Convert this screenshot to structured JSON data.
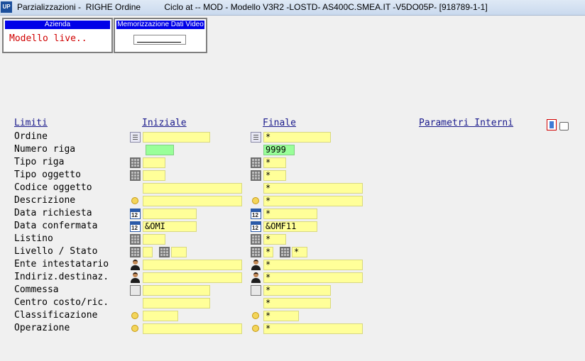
{
  "window": {
    "app_icon": "UP",
    "title": "Parzializzazioni -  RIGHE Ordine          Ciclo at -- MOD - Modello V3R2 -LOSTD- AS400C.SMEA.IT -V5DO05P- [918789-1-1]"
  },
  "azienda": {
    "header": "Azienda",
    "value": "Modello live.."
  },
  "memorizzazione": {
    "header": "Memorizzazione Dati Video",
    "value": ""
  },
  "columns": {
    "limiti": "Limiti",
    "iniziale": "Iniziale",
    "finale": "Finale",
    "parametri": "Parametri Interni"
  },
  "rows": [
    {
      "label": "Ordine",
      "icon": "document-list-icon",
      "ini": "",
      "fin": "*"
    },
    {
      "label": "Numero riga",
      "icon": "",
      "ini": "",
      "fin": "9999"
    },
    {
      "label": "Tipo riga",
      "icon": "table-grid-icon",
      "ini": "",
      "fin": "*"
    },
    {
      "label": "Tipo oggetto",
      "icon": "table-grid-icon",
      "ini": "",
      "fin": "*"
    },
    {
      "label": "Codice oggetto",
      "icon": "",
      "ini": "",
      "fin": "*"
    },
    {
      "label": "Descrizione",
      "icon": "circle-icon",
      "ini": "",
      "fin": "*"
    },
    {
      "label": "Data richiesta",
      "icon": "calendar-icon",
      "ini": "",
      "fin": "*"
    },
    {
      "label": "Data confermata",
      "icon": "calendar-icon",
      "ini": "&OMI",
      "fin": "&OMF11"
    },
    {
      "label": "Listino",
      "icon": "table-grid-icon",
      "ini": "",
      "fin": "*"
    },
    {
      "label": "Livello / Stato",
      "icon": "table-grid-icon",
      "ini": "",
      "ini2": "",
      "fin": "*",
      "fin2": "*"
    },
    {
      "label": "Ente intestatario",
      "icon": "person-icon",
      "ini": "",
      "fin": "*"
    },
    {
      "label": "Indiriz.destinaz.",
      "icon": "person-icon",
      "ini": "",
      "fin": "*"
    },
    {
      "label": "Commessa",
      "icon": "money-doc-icon",
      "ini": "",
      "fin": "*"
    },
    {
      "label": "Centro costo/ric.",
      "icon": "dollar-icon",
      "ini": "",
      "fin": "*"
    },
    {
      "label": "Classificazione",
      "icon": "circle-icon",
      "ini": "",
      "fin": "*"
    },
    {
      "label": "Operazione",
      "icon": "circle-icon",
      "ini": "",
      "fin": "*"
    }
  ],
  "colors": {
    "field_yellow": "#ffff99",
    "field_green": "#99ff99",
    "header_blue": "#0000e8",
    "link_blue": "#1a1a8c",
    "value_red": "#d00000"
  }
}
